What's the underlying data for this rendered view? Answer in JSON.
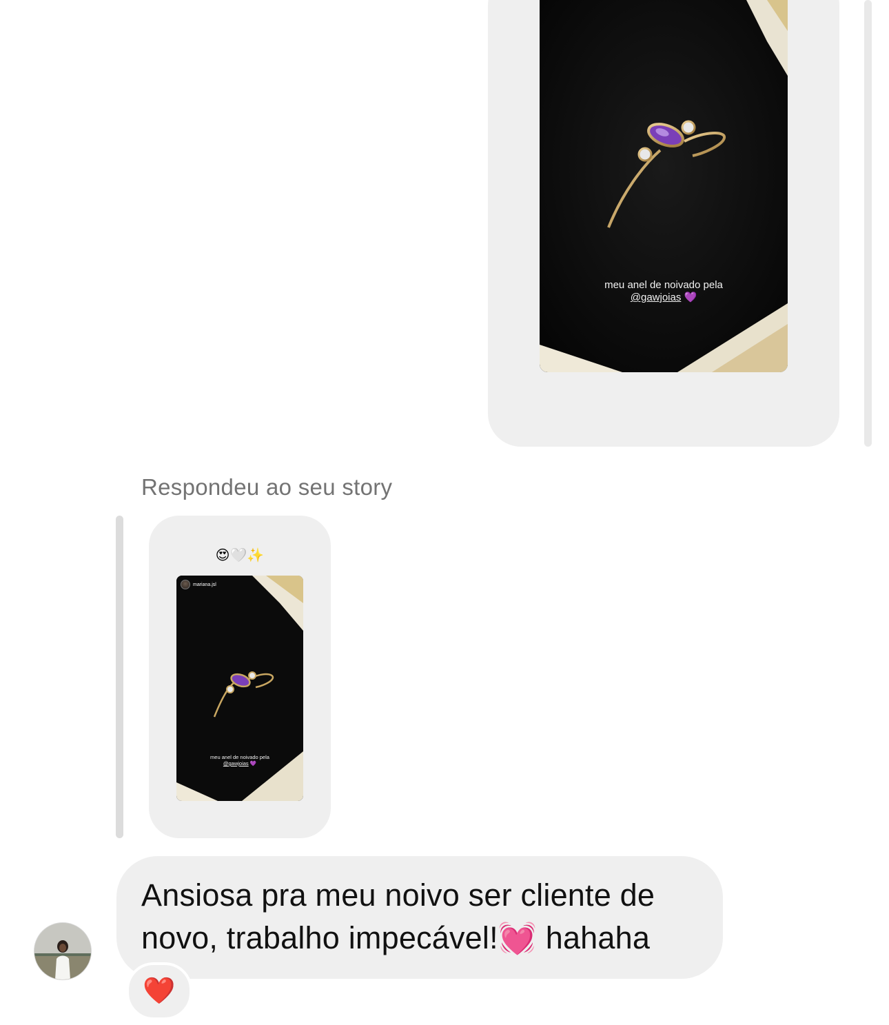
{
  "shared_story_top": {
    "caption_line1": "meu anel de noivado pela",
    "caption_handle": "@gawjoias",
    "caption_emoji": "💜"
  },
  "reply": {
    "label": "Respondeu ao seu story",
    "story_emojis": "😍🤍✨",
    "story_username": "mariana.jsl",
    "caption_line1": "meu anel de noivado pela",
    "caption_handle": "@gawjoias",
    "caption_emoji": "💜"
  },
  "message": {
    "text": "Ansiosa pra meu noivo ser cliente de\nnovo, trabalho impecável!💓 hahaha",
    "reaction": "❤️"
  },
  "icons": {
    "avatar": "user-avatar",
    "reaction": "heart-reaction-icon"
  }
}
